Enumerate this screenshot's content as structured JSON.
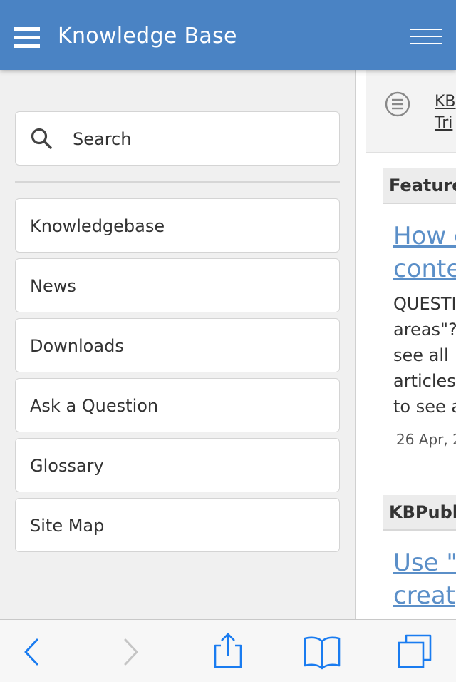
{
  "header": {
    "title": "Knowledge Base",
    "menu_icon": "hamburger-menu-icon",
    "nav_toggle_icon": "navigation-toggle-icon"
  },
  "sidebar": {
    "search": {
      "placeholder": "Search",
      "value": "",
      "icon": "search-icon"
    },
    "items": [
      {
        "label": "Knowledgebase"
      },
      {
        "label": "News"
      },
      {
        "label": "Downloads"
      },
      {
        "label": "Ask a Question"
      },
      {
        "label": "Glossary"
      },
      {
        "label": "Site Map"
      }
    ]
  },
  "content": {
    "toc": {
      "icon": "list-icon",
      "line1": "KB",
      "line2": "Tri"
    },
    "sections": [
      {
        "heading": "Feature",
        "article": {
          "title_line1": "How c",
          "title_line2": "conte",
          "excerpt_lines": [
            "QUESTI",
            "areas\"?",
            "see all",
            "articles",
            "to see a"
          ],
          "date": "26 Apr, 2"
        }
      },
      {
        "heading": "KBPubl",
        "article": {
          "title_line1": "Use \"",
          "title_line2": "creat"
        }
      }
    ]
  },
  "toolbar": {
    "back_icon": "back-chevron-icon",
    "forward_icon": "forward-chevron-icon",
    "share_icon": "share-icon",
    "bookmarks_icon": "bookmarks-book-icon",
    "tabs_icon": "tabs-icon",
    "accent_color": "#1a7cf0",
    "disabled_color": "#c5c5c5"
  },
  "colors": {
    "header_bg": "#4a83c4",
    "link": "#5b8fc8",
    "sidebar_bg": "#f0f0f0"
  }
}
